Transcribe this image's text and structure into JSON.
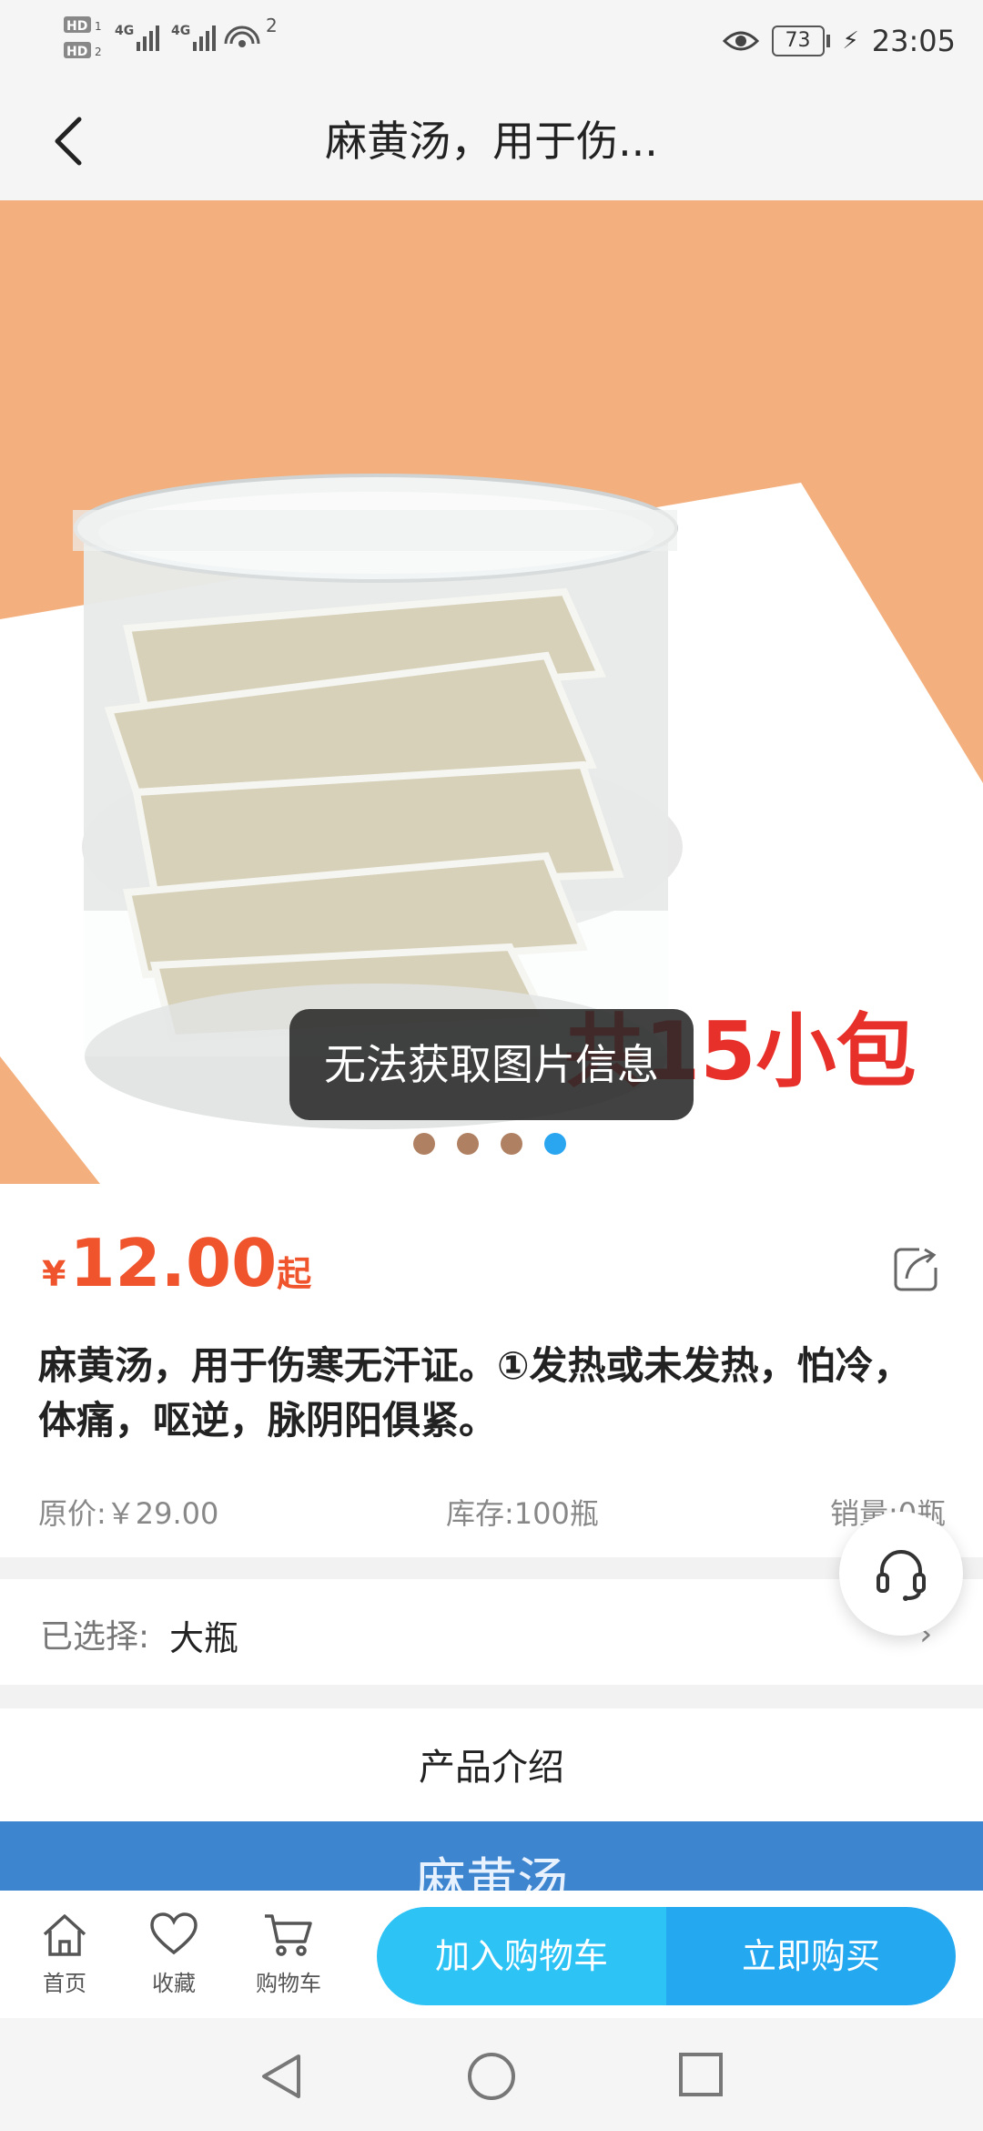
{
  "status_bar": {
    "network_left": "HD",
    "signal_1": "4G",
    "signal_2": "4G",
    "hotspot_count": "2",
    "battery": "73",
    "time": "23:05"
  },
  "header": {
    "title": "麻黄汤，用于伤..."
  },
  "hero": {
    "overlay_text": "共15小包",
    "toast": "无法获取图片信息",
    "slide_count": 4,
    "active_slide": 4
  },
  "product": {
    "currency": "¥",
    "price": "12.00",
    "price_suffix": "起",
    "description": "麻黄汤，用于伤寒无汗证。①发热或未发热，怕冷，体痛，呕逆，脉阴阳俱紧。",
    "original_price": "原价:￥29.00",
    "stock": "库存:100瓶",
    "sales": "销量:0瓶"
  },
  "selection": {
    "label": "已选择:",
    "value": "大瓶",
    "chevron": "›"
  },
  "intro": {
    "title": "产品介绍",
    "banner": "麻黄汤"
  },
  "bottom_nav": {
    "home": "首页",
    "favorites": "收藏",
    "cart": "购物车",
    "add_to_cart": "加入购物车",
    "buy_now": "立即购买"
  },
  "colors": {
    "price": "#f0542d",
    "accent": "#2ec3f5",
    "hero_bg": "#f3b07e",
    "banner": "#3e85cf"
  }
}
